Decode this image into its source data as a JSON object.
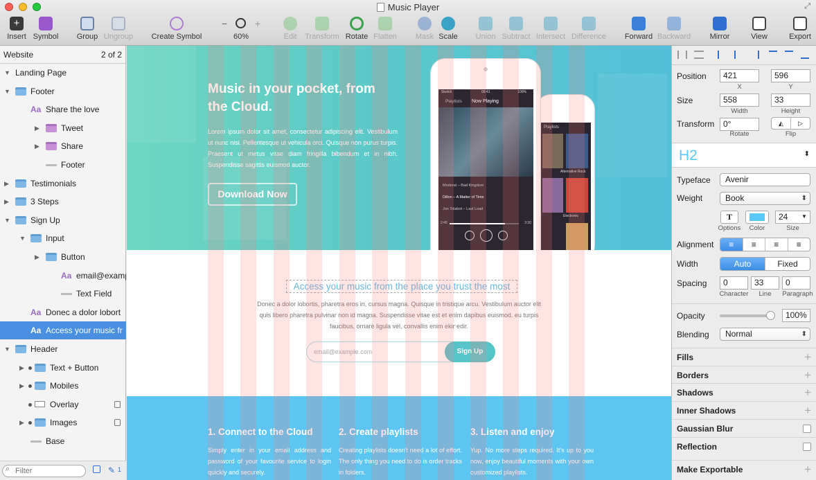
{
  "window": {
    "title": "Music Player"
  },
  "toolbar": {
    "insert": "Insert",
    "symbol": "Symbol",
    "group": "Group",
    "ungroup": "Ungroup",
    "create_symbol": "Create Symbol",
    "zoom": "60%",
    "zoom_minus": "−",
    "zoom_plus": "+",
    "edit": "Edit",
    "transform": "Transform",
    "rotate": "Rotate",
    "flatten": "Flatten",
    "mask": "Mask",
    "scale": "Scale",
    "union": "Union",
    "subtract": "Subtract",
    "intersect": "Intersect",
    "difference": "Difference",
    "forward": "Forward",
    "backward": "Backward",
    "mirror": "Mirror",
    "view": "View",
    "export": "Export"
  },
  "layers": {
    "page": "Website",
    "page_count": "2 of 2",
    "filter_placeholder": "Filter",
    "edit_count": "1",
    "items": [
      {
        "label": "Landing Page",
        "kind": "artboard"
      },
      {
        "label": "Footer",
        "kind": "folder"
      },
      {
        "label": "Share the love",
        "kind": "text"
      },
      {
        "label": "Tweet",
        "kind": "symbol"
      },
      {
        "label": "Share",
        "kind": "symbol"
      },
      {
        "label": "Footer",
        "kind": "shape"
      },
      {
        "label": "Testimonials",
        "kind": "folder"
      },
      {
        "label": "3 Steps",
        "kind": "folder"
      },
      {
        "label": "Sign Up",
        "kind": "folder"
      },
      {
        "label": "Input",
        "kind": "folder"
      },
      {
        "label": "Button",
        "kind": "folder"
      },
      {
        "label": "email@example...",
        "kind": "text"
      },
      {
        "label": "Text Field",
        "kind": "shape"
      },
      {
        "label": "Donec a dolor lobort",
        "kind": "text"
      },
      {
        "label": "Access your music fr",
        "kind": "text"
      },
      {
        "label": "Header",
        "kind": "artboard"
      },
      {
        "label": "Text + Button",
        "kind": "folder"
      },
      {
        "label": "Mobiles",
        "kind": "folder"
      },
      {
        "label": "Overlay",
        "kind": "rect"
      },
      {
        "label": "Images",
        "kind": "folder"
      },
      {
        "label": "Base",
        "kind": "shape"
      }
    ]
  },
  "canvas": {
    "hero_title": "Music in your pocket, from the Cloud.",
    "hero_body": "Lorem ipsum dolor sit amet, consectetur adipiscing elit. Vestibulum ut nunc nisi. Pellentesque ut vehicula orci. Quisque non purus turpis. Praesent ut metus vitae diam fringilla bibendum et in nibh. Suspendisse sagittis euismod auctor.",
    "download_button": "Download Now",
    "access_heading": "Access your music from the place you trust the most",
    "access_body": "Donec a dolor lobortis, pharetra eros in, cursus magna. Quisque in tristique arcu. Vestibulum auctor elit quis libero pharetra pulvinar non id magna. Suspendisse vitae est et enim dapibus euismod. eu turpis faucibus, ornare ligula vel, convallis enim ekir edir.",
    "email_placeholder": "email@example.com",
    "signup_button": "Sign Up",
    "steps": [
      {
        "title": "1. Connect to the Cloud",
        "body": "Simply enter in your email address and password of your favourite service to login quickly and securely."
      },
      {
        "title": "2. Create playlists",
        "body": "Creating playlists doesn't need a lot of effort. The only thing you need to do is order tracks in folders."
      },
      {
        "title": "3. Listen and enjoy",
        "body": "Yup. No more steps required. It's up to you now, enjoy beautiful moments with your own customized playlists."
      }
    ],
    "phone_front": {
      "carrier": "Sketch",
      "time": "09:41",
      "battery": "100%",
      "back": "Playlists",
      "screen_title": "Now Playing",
      "tracks": [
        "Moderat – Bad Kingdom",
        "Dillon – A Matter of Time",
        "Jon Tolabot – Last Load"
      ],
      "elapsed": "2:45",
      "duration": "3:30"
    },
    "phone_back": {
      "back": "Playlists",
      "tiles": [
        "Alternative Rock",
        "Electronic"
      ]
    }
  },
  "inspector": {
    "position_label": "Position",
    "x": "421",
    "y": "596",
    "x_sub": "X",
    "y_sub": "Y",
    "size_label": "Size",
    "width": "558",
    "height": "33",
    "width_sub": "Width",
    "height_sub": "Height",
    "transform_label": "Transform",
    "rotate": "0°",
    "rotate_sub": "Rotate",
    "flip_sub": "Flip",
    "style_name": "H2",
    "typeface_label": "Typeface",
    "typeface": "Avenir",
    "weight_label": "Weight",
    "weight": "Book",
    "options_sub": "Options",
    "color_sub": "Color",
    "font_size": "24",
    "size_sub": "Size",
    "alignment_label": "Alignment",
    "width_mode_label": "Width",
    "auto": "Auto",
    "fixed": "Fixed",
    "spacing_label": "Spacing",
    "character": "0",
    "line": "33",
    "paragraph": "0",
    "character_sub": "Character",
    "line_sub": "Line",
    "paragraph_sub": "Paragraph",
    "opacity_label": "Opacity",
    "opacity": "100%",
    "opacity_value": 1.0,
    "blending_label": "Blending",
    "blending": "Normal",
    "text_color": "#5ac8fa",
    "sections": [
      "Fills",
      "Borders",
      "Shadows",
      "Inner Shadows",
      "Gaussian Blur",
      "Reflection"
    ],
    "exportable": "Make Exportable"
  }
}
